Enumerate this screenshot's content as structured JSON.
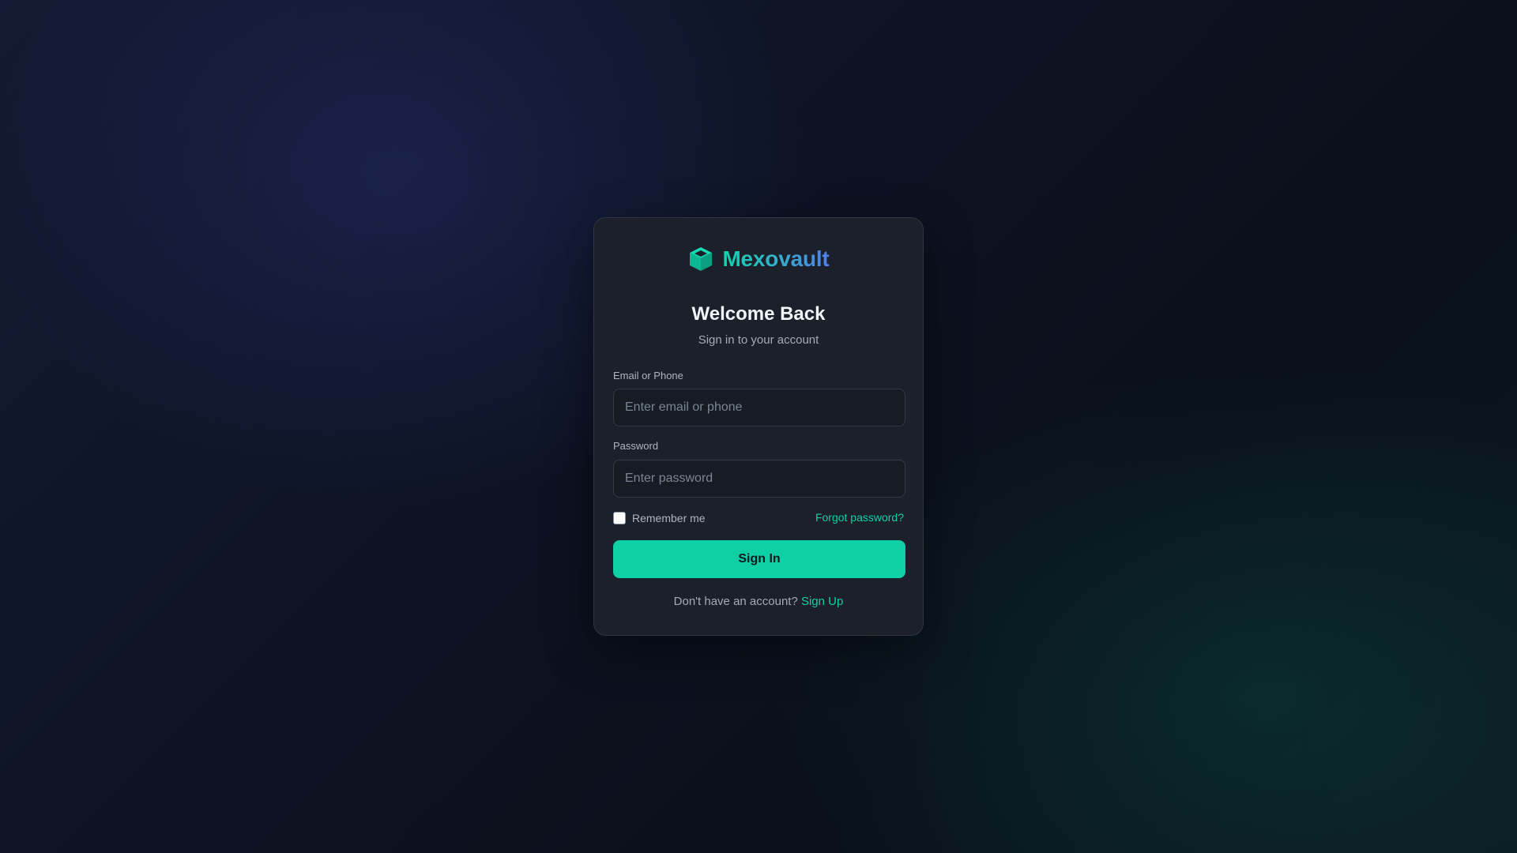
{
  "brand": {
    "name": "Mexovault",
    "icon": "cube-icon",
    "accent_color": "#0ecfa6",
    "gradient": [
      "#10d3aa",
      "#4f7fe8"
    ]
  },
  "login": {
    "title": "Welcome Back",
    "subtitle": "Sign in to your account",
    "email": {
      "label": "Email or Phone",
      "placeholder": "Enter email or phone",
      "value": ""
    },
    "password": {
      "label": "Password",
      "placeholder": "Enter password",
      "value": ""
    },
    "remember": {
      "label": "Remember me",
      "checked": false
    },
    "forgot_label": "Forgot password?",
    "submit_label": "Sign In",
    "signup_prompt": "Don't have an account?",
    "signup_label": "Sign Up"
  }
}
